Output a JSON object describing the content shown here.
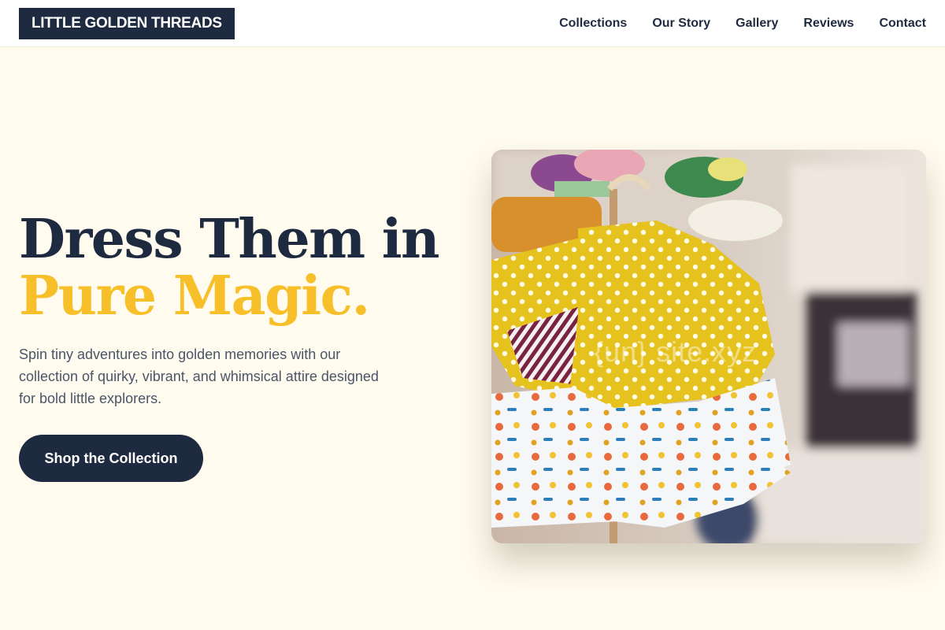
{
  "header": {
    "logo_text": "LITTLE GOLDEN THREADS",
    "nav": [
      {
        "label": "Collections"
      },
      {
        "label": "Our Story"
      },
      {
        "label": "Gallery"
      },
      {
        "label": "Reviews"
      },
      {
        "label": "Contact"
      }
    ]
  },
  "hero": {
    "title_line1": "Dress Them in",
    "title_line2": "Pure Magic.",
    "description": "Spin tiny adventures into golden memories with our collection of quirky, vibrant, and whimsical attire designed for bold little explorers.",
    "cta_label": "Shop the Collection",
    "image_watermark": "{un} site.xyz"
  },
  "colors": {
    "navy": "#1e2a3f",
    "gold": "#f7c02a",
    "page_background": "#fffbef",
    "body_text": "#4a5568"
  },
  "icons": {
    "hero_image": "childrens-dresses-photo"
  }
}
